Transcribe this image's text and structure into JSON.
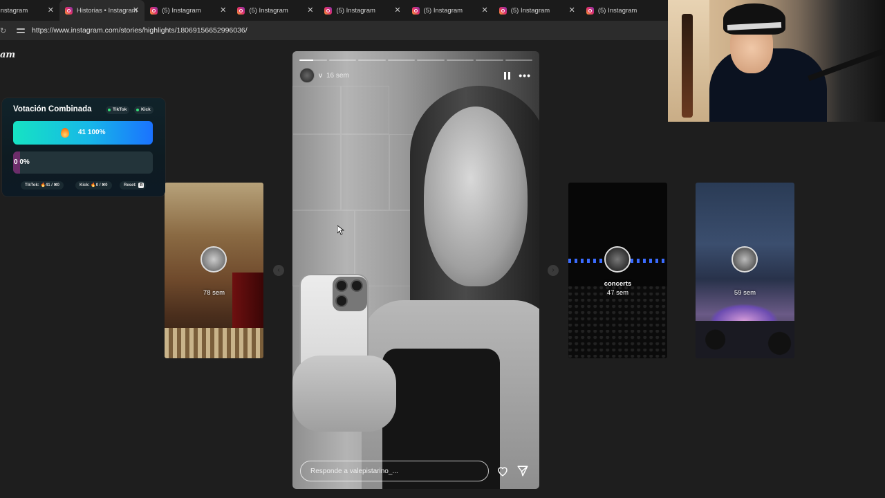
{
  "browser": {
    "tabs": [
      {
        "label": "Instagram",
        "active": false
      },
      {
        "label": "Historias • Instagram",
        "active": true
      },
      {
        "label": "(5) Instagram",
        "active": false
      },
      {
        "label": "(5) Instagram",
        "active": false
      },
      {
        "label": "(5) Instagram",
        "active": false
      },
      {
        "label": "(5) Instagram",
        "active": false
      },
      {
        "label": "(5) Instagram",
        "active": false
      },
      {
        "label": "(5) Instagram",
        "active": false
      }
    ],
    "close_glyph": "✕",
    "url": "https://www.instagram.com/stories/highlights/18069156652996036/"
  },
  "page": {
    "logo_fragment": "am"
  },
  "story": {
    "username": "v",
    "time": "16 sem",
    "progress_segments": 8,
    "progress_current": 0.5,
    "reply_placeholder": "Responde a valepistarino_..."
  },
  "previews": [
    {
      "label": "",
      "time": "78 sem"
    },
    {
      "label": "concerts",
      "time": "47 sem"
    },
    {
      "label": "",
      "time": "59 sem"
    }
  ],
  "vote_overlay": {
    "title": "Votación Combinada",
    "platform_tiktok": "TikTok",
    "platform_kick": "Kick",
    "option1": {
      "text": "41  100%",
      "percent": 100
    },
    "option2": {
      "text": "0  0%",
      "percent": 0
    },
    "stat_tiktok": "TikTok: 🔥41 / ✖0",
    "stat_kick": "Kick: 🔥0 / ✖0",
    "stat_reset": "Reset:",
    "reset_key": "R"
  },
  "colors": {
    "accent_gradient_start": "#16e3c3",
    "accent_gradient_end": "#1a72ff",
    "instagram_brand": "#e1306c"
  }
}
